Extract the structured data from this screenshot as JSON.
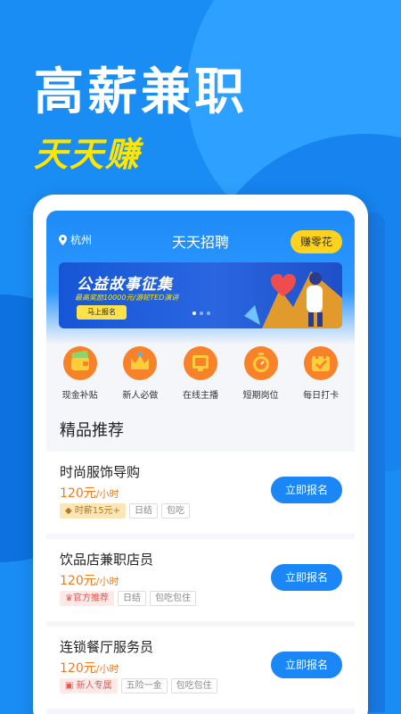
{
  "hero": {
    "title": "高薪兼职",
    "subtitle": "天天赚"
  },
  "header": {
    "location": "杭州",
    "title": "天天招聘",
    "earn_button": "赚零花"
  },
  "banner": {
    "title": "公益故事征集",
    "subtitle": "最高奖励10000元/游轮TED演讲",
    "button": "马上报名"
  },
  "categories": [
    {
      "label": "现金补贴",
      "icon": "wallet-icon"
    },
    {
      "label": "新人必做",
      "icon": "crown-icon"
    },
    {
      "label": "在线主播",
      "icon": "tv-icon"
    },
    {
      "label": "短期岗位",
      "icon": "stopwatch-icon"
    },
    {
      "label": "每日打卡",
      "icon": "calendar-check-icon"
    }
  ],
  "section_title": "精品推荐",
  "jobs": [
    {
      "title": "时尚服饰导购",
      "pay": "120元",
      "unit": "/小时",
      "tags": [
        "时薪15元+",
        "日结",
        "包吃"
      ],
      "button": "立即报名"
    },
    {
      "title": "饮品店兼职店员",
      "pay": "120元",
      "unit": "/小时",
      "tags": [
        "官方推荐",
        "日结",
        "包吃包住"
      ],
      "button": "立即报名"
    },
    {
      "title": "连锁餐厅服务员",
      "pay": "120元",
      "unit": "/小时",
      "tags": [
        "新人专属",
        "五险一金",
        "包吃包住"
      ],
      "button": "立即报名"
    }
  ],
  "colors": {
    "primary": "#1b86f5",
    "accent_yellow": "#ffd31d",
    "pay_orange": "#f37a1f",
    "category_orange": "#f7822a"
  }
}
